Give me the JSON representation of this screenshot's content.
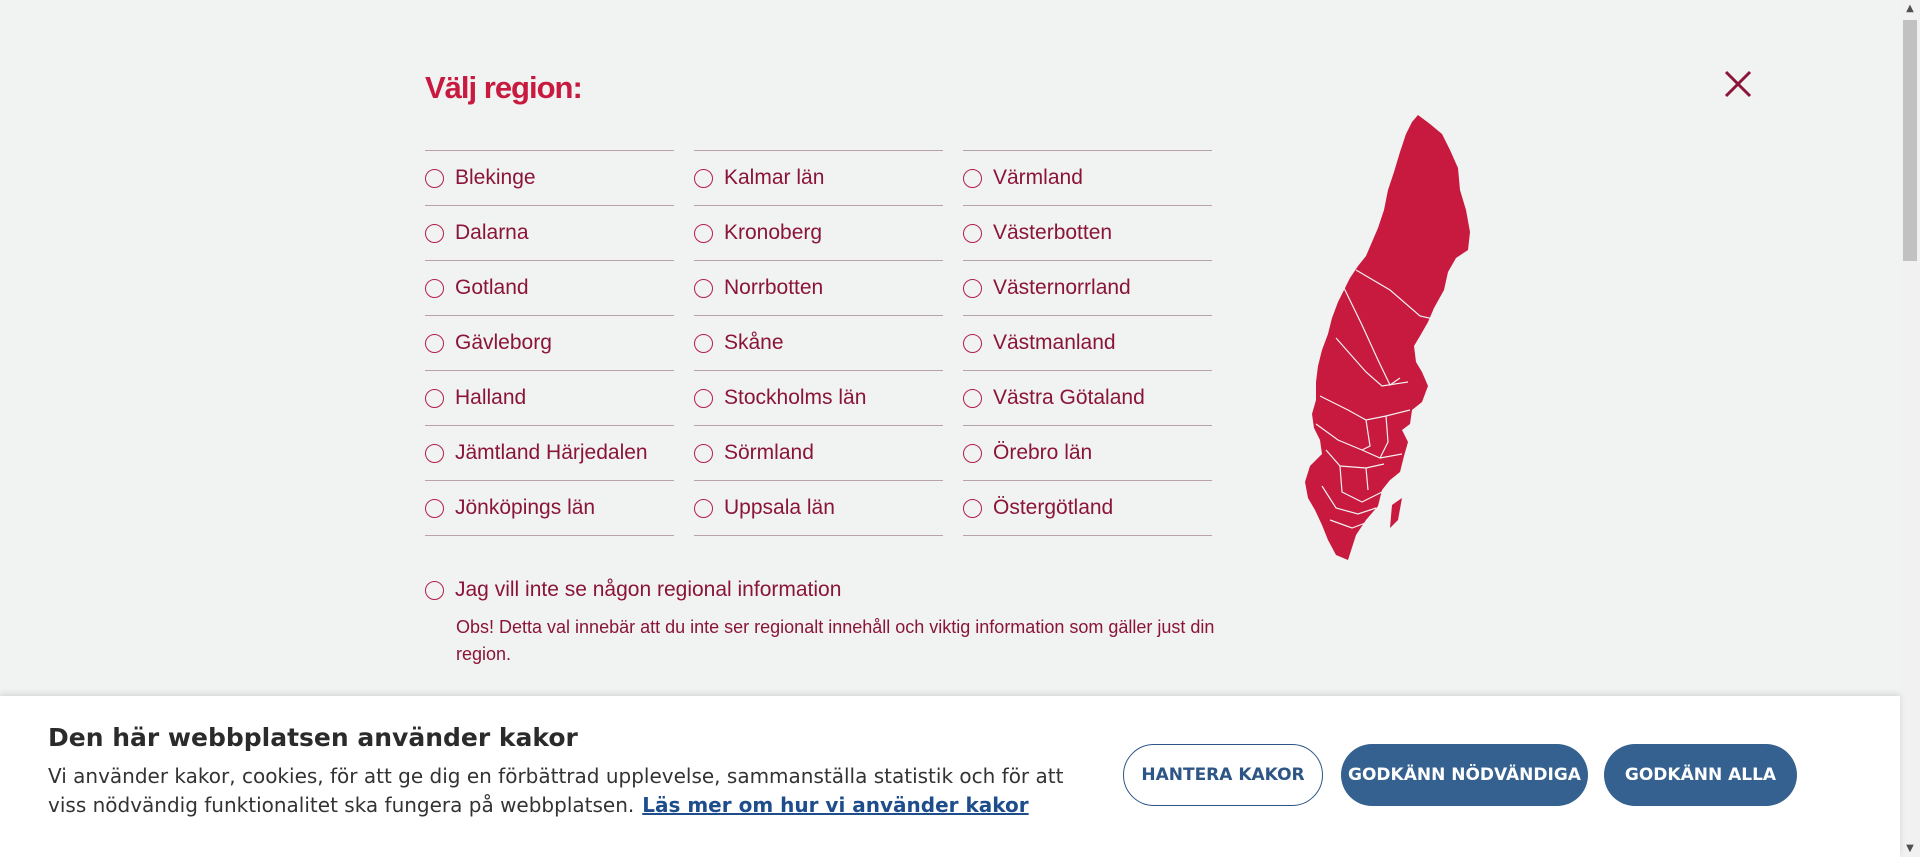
{
  "modal": {
    "title": "Välj region:",
    "close_icon": "close-icon",
    "regions": {
      "col1": [
        "Blekinge",
        "Dalarna",
        "Gotland",
        "Gävleborg",
        "Halland",
        "Jämtland Härjedalen",
        "Jönköpings län"
      ],
      "col2": [
        "Kalmar län",
        "Kronoberg",
        "Norrbotten",
        "Skåne",
        "Stockholms län",
        "Sörmland",
        "Uppsala län"
      ],
      "col3": [
        "Värmland",
        "Västerbotten",
        "Västernorrland",
        "Västmanland",
        "Västra Götaland",
        "Örebro län",
        "Östergötland"
      ]
    },
    "no_region_label": "Jag vill inte se någon regional information",
    "no_region_note": "Obs! Detta val innebär att du inte ser regionalt innehåll och viktig information som gäller just din region.",
    "map_icon": "sweden-map-icon"
  },
  "cookie": {
    "title": "Den här webbplatsen använder kakor",
    "text": "Vi använder kakor, cookies, för att ge dig en förbättrad upplevelse, sammanställa statistik och för att viss nödvändig funktionalitet ska fungera på webbplatsen.",
    "link": "Läs mer om hur vi använder kakor",
    "buttons": {
      "manage": "HANTERA KAKOR",
      "necessary": "GODKÄNN NÖDVÄNDIGA",
      "all": "GODKÄNN ALLA"
    }
  },
  "colors": {
    "accent": "#c8193e",
    "text": "#8a1538",
    "button": "#34618f"
  }
}
